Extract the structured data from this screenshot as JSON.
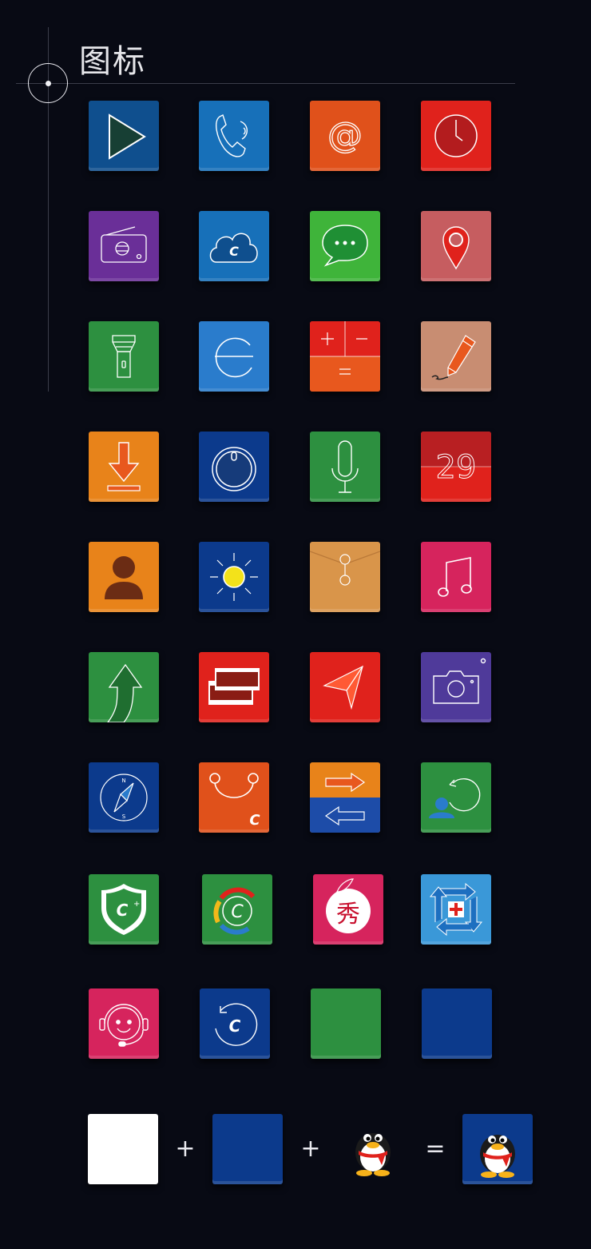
{
  "page": {
    "title": "图标"
  },
  "colors": {
    "background": "#080a14",
    "deco_line": "#3a3d4a"
  },
  "icons": [
    {
      "name": "play-icon",
      "bg": "#0f4f8e"
    },
    {
      "name": "phone-icon",
      "bg": "#1770b9"
    },
    {
      "name": "email-icon",
      "bg": "#e0511b"
    },
    {
      "name": "clock-icon",
      "bg": "#e0221c"
    },
    {
      "name": "radio-icon",
      "bg": "#6a2f98"
    },
    {
      "name": "cloud-icon",
      "bg": "#1770b9"
    },
    {
      "name": "message-icon",
      "bg": "#3fb43a"
    },
    {
      "name": "location-pin-icon",
      "bg": "#c65d60"
    },
    {
      "name": "flashlight-icon",
      "bg": "#2d9040"
    },
    {
      "name": "browser-icon",
      "bg": "#2a7ccc"
    },
    {
      "name": "calculator-icon",
      "bg": "#e0221c"
    },
    {
      "name": "pencil-icon",
      "bg": "#c88d72"
    },
    {
      "name": "download-icon",
      "bg": "#e8831a"
    },
    {
      "name": "power-icon",
      "bg": "#0c3a8c"
    },
    {
      "name": "microphone-icon",
      "bg": "#2d9040"
    },
    {
      "name": "calendar-icon",
      "bg": "#e0221c"
    },
    {
      "name": "contact-icon",
      "bg": "#e8831a"
    },
    {
      "name": "brightness-icon",
      "bg": "#0c3a8c"
    },
    {
      "name": "envelope-file-icon",
      "bg": "#d9954a"
    },
    {
      "name": "music-icon",
      "bg": "#d6245d"
    },
    {
      "name": "navigation-arrow-icon",
      "bg": "#2d9040"
    },
    {
      "name": "film-icon",
      "bg": "#e0221c"
    },
    {
      "name": "send-icon",
      "bg": "#e0221c"
    },
    {
      "name": "camera-icon",
      "bg": "#4f3a9a"
    },
    {
      "name": "compass-icon",
      "bg": "#0c3a8c"
    },
    {
      "name": "shopping-bag-icon",
      "bg": "#e0511b"
    },
    {
      "name": "transfer-icon",
      "bg": "#e8831a"
    },
    {
      "name": "user-sync-icon",
      "bg": "#2d9040"
    },
    {
      "name": "security-shield-icon",
      "bg": "#2d9040"
    },
    {
      "name": "app-logo-icon",
      "bg": "#2d9040"
    },
    {
      "name": "xiu-icon",
      "bg": "#d6245d"
    },
    {
      "name": "repair-icon",
      "bg": "#3a98d8"
    },
    {
      "name": "support-headset-icon",
      "bg": "#d6245d"
    },
    {
      "name": "backup-restore-icon",
      "bg": "#0c3a8c"
    },
    {
      "name": "green-blank-tile",
      "bg": "#2d9040"
    },
    {
      "name": "blue-blank-tile",
      "bg": "#0c3a8c"
    }
  ],
  "formula": {
    "plus_1": "+",
    "plus_2": "+",
    "equals": "=",
    "white_tile_color": "#ffffff",
    "blue_tile_color": "#0c3a8c",
    "result_tile_color": "#0c3a8c"
  }
}
